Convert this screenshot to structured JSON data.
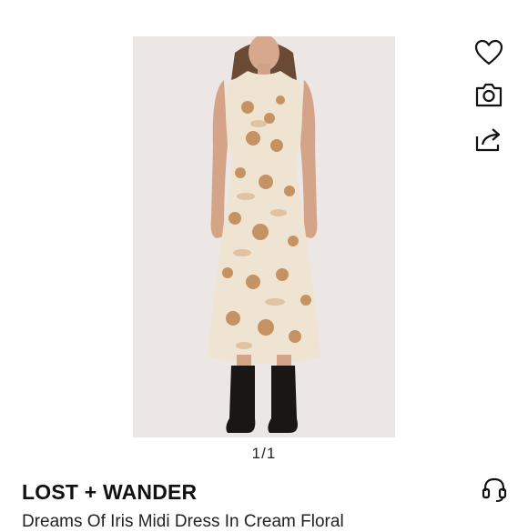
{
  "product": {
    "image_alt": "Model wearing a cream floral sleeveless midi dress with black lace-up boots",
    "image_counter": "1/1",
    "brand": "LOST + WANDER",
    "title": "Dreams Of Iris Midi Dress In Cream Floral"
  },
  "actions": {
    "like_icon": "heart-icon",
    "camera_icon": "camera-icon",
    "share_icon": "share-icon",
    "support_icon": "headset-icon"
  },
  "colors": {
    "image_background": "#ece6e4",
    "dress": "#efe4d2",
    "floral": "#b8783e",
    "text": "#111111"
  }
}
